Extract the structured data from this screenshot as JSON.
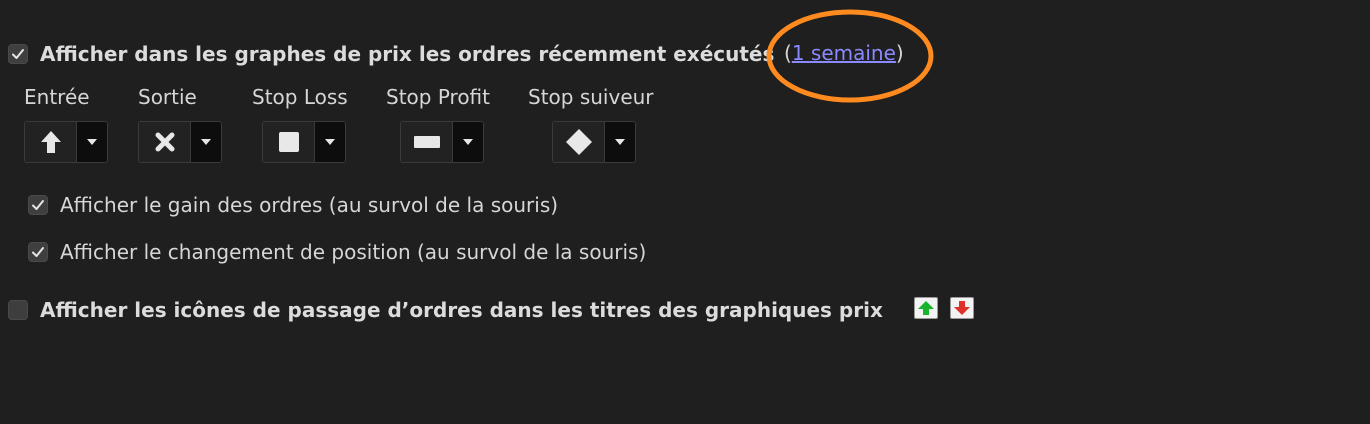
{
  "orders": {
    "show_recent_checked": true,
    "show_recent_label": "Afficher dans les graphes de prix les ordres récemment exécutés",
    "period_open": "(",
    "period_link": "1 semaine",
    "period_close": ")"
  },
  "markers": [
    {
      "header": "Entrée",
      "icon": "up-arrow-icon"
    },
    {
      "header": "Sortie",
      "icon": "cross-icon"
    },
    {
      "header": "Stop Loss",
      "icon": "square-icon"
    },
    {
      "header": "Stop Profit",
      "icon": "bar-icon"
    },
    {
      "header": "Stop suiveur",
      "icon": "diamond-icon"
    }
  ],
  "options": {
    "show_gain_checked": true,
    "show_gain_label": "Afficher le gain des ordres (au survol de la souris)",
    "show_position_change_checked": true,
    "show_position_change_label": "Afficher le changement de position (au survol de la souris)",
    "show_order_icons_checked": false,
    "show_order_icons_label": "Afficher les icônes de passage d’ordres dans les titres des graphiques prix"
  },
  "colors": {
    "background": "#1f1f1f",
    "link": "#8a8aff",
    "highlight_ellipse": "#ff8a1f",
    "buy_icon": "#17b32a",
    "sell_icon": "#e0302a"
  }
}
